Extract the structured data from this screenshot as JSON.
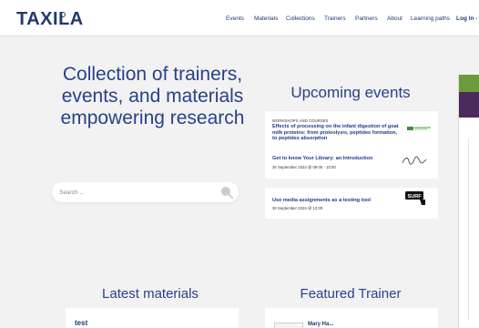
{
  "brand": {
    "logo_text": "TAXILA"
  },
  "nav": {
    "items": [
      "Events",
      "Materials",
      "Collections",
      "Trainers",
      "Partners",
      "About",
      "Learning paths"
    ],
    "login": "Log In -"
  },
  "hero": {
    "title": "Collection of trainers, events, and materials empowering research"
  },
  "search": {
    "placeholder": "Search ..."
  },
  "events": {
    "title": "Upcoming events",
    "items": [
      {
        "tag": "WORKSHOPS AND COURSES",
        "title": "Effects of processing on the infant digestion of goat milk proteins: from proteolysis, peptides formation, to peptides absorption",
        "time": "30 September 2024 @ 08:30 - 10:00",
        "logo": "organization-logo"
      },
      {
        "tag": "",
        "title": "Get to know Your Library: an Introduction",
        "time": "30 September 2024 @ 09:00 - 10:00",
        "logo": "signature-logo"
      },
      {
        "tag": "",
        "title": "Use media assignments as a testing tool",
        "time": "30 September 2024 @ 12:00",
        "logo": "surf-logo"
      }
    ]
  },
  "materials": {
    "title": "Latest materials",
    "items": [
      {
        "title": "test"
      }
    ]
  },
  "trainer": {
    "title": "Featured Trainer",
    "name": "Mary Ha..."
  },
  "colors": {
    "primary": "#27408b",
    "background": "#f2f2f2",
    "card": "#ffffff",
    "accent_green": "#6d9a3a",
    "accent_purple": "#4d2a5e"
  }
}
